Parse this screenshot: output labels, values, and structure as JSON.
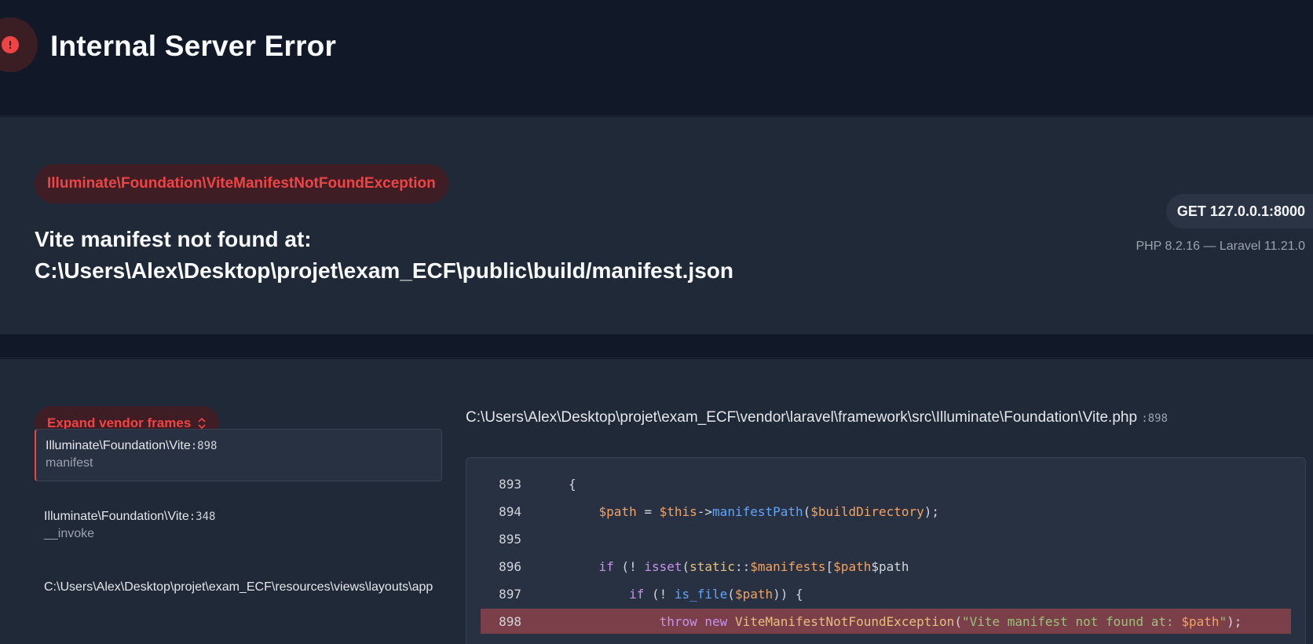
{
  "page": {
    "title": "Internal Server Error"
  },
  "exception": {
    "class": "Illuminate\\Foundation\\ViteManifestNotFoundException",
    "message": "Vite manifest not found at: C:\\Users\\Alex\\Desktop\\projet\\exam_ECF\\public\\build/manifest.json"
  },
  "request": {
    "method_url": "GET 127.0.0.1:8000",
    "versions": "PHP 8.2.16 — Laravel 11.21.0"
  },
  "frames": {
    "expand_label": "Expand vendor frames",
    "items": [
      {
        "class": "Illuminate\\Foundation\\Vite",
        "line": ":898",
        "function": "manifest"
      },
      {
        "class": "Illuminate\\Foundation\\Vite",
        "line": ":348",
        "function": "__invoke"
      },
      {
        "class": "C:\\Users\\Alex\\Desktop\\projet\\exam_ECF\\resources\\views\\layouts\\app.blade.php",
        "line": "",
        "function": ""
      }
    ]
  },
  "source": {
    "file_path": "C:\\Users\\Alex\\Desktop\\projet\\exam_ECF\\vendor\\laravel\\framework\\src\\Illuminate\\Foundation\\Vite.php",
    "line": ":898",
    "line_numbers": [
      "893",
      "894",
      "895",
      "896",
      "897",
      "898"
    ],
    "highlighted_line": "898",
    "code": {
      "l893": "{",
      "l894": [
        "$path",
        " = ",
        "$this",
        "->",
        "manifestPath",
        "(",
        "$buildDirectory",
        ");"
      ],
      "l896": [
        "if",
        " (! ",
        "isset",
        "(",
        "static",
        "::",
        "$manifests",
        "[",
        "$path",
        "])) {"
      ],
      "l897": [
        "if",
        " (! ",
        "is_file",
        "(",
        "$path",
        ")) {"
      ],
      "l898": [
        "throw",
        " ",
        "new",
        " ",
        "ViteManifestNotFoundException",
        "(",
        "\"Vite manifest not found at: ",
        "$path",
        "\"",
        ");"
      ]
    }
  },
  "colors": {
    "accent": "#ef4444",
    "highlight_line": "#7a3f49"
  }
}
